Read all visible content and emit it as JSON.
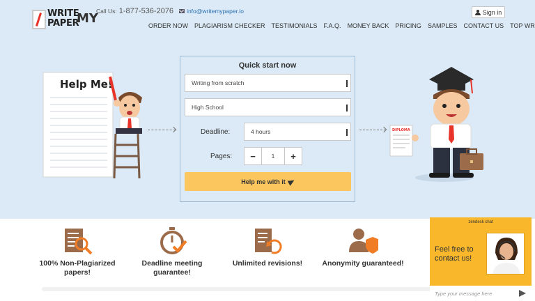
{
  "header": {
    "logo": {
      "line1": "WRITE",
      "line2": "PAPER",
      "line3": "MY"
    },
    "contact": {
      "call_label": "Call Us:",
      "phone": "1-877-536-2076",
      "email": "info@writemypaper.io"
    },
    "signin_label": "Sign in",
    "nav": [
      "ORDER NOW",
      "PLAGIARISM CHECKER",
      "TESTIMONIALS",
      "F.A.Q.",
      "MONEY BACK",
      "PRICING",
      "SAMPLES",
      "CONTACT US",
      "TOP WRITERS"
    ]
  },
  "hero": {
    "help_sign": "Help Me!",
    "diploma_label": "DIPLOMA",
    "quick_start": {
      "title": "Quick start now",
      "service_value": "Writing from scratch",
      "level_value": "High School",
      "deadline_label": "Deadline:",
      "deadline_value": "4 hours",
      "pages_label": "Pages:",
      "pages_value": "1",
      "minus": "−",
      "plus": "+",
      "cta_label": "Help me with it"
    }
  },
  "features": [
    {
      "icon": "plagiarism-check-icon",
      "text": "100% Non-Plagiarized papers!"
    },
    {
      "icon": "stopwatch-deadline-icon",
      "text": "Deadline meeting guarantee!"
    },
    {
      "icon": "revision-document-icon",
      "text": "Unlimited revisions!"
    },
    {
      "icon": "anonymity-shield-icon",
      "text": "Anonymity guaranteed!"
    }
  ],
  "chat": {
    "title": "zendesk chat",
    "message": "Feel free to contact us!",
    "placeholder": "Type your message here"
  },
  "colors": {
    "accent": "#f9b72b",
    "cta": "#fbc65d",
    "hero_bg": "#dbeaf6",
    "icon_orange": "#f07c25",
    "icon_brown": "#9b6b4a"
  }
}
